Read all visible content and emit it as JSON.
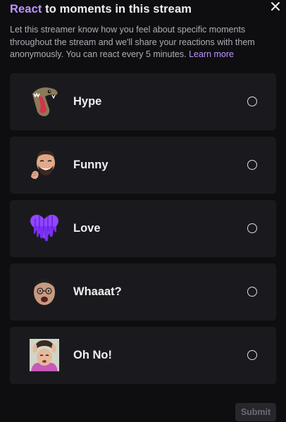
{
  "header": {
    "title_accent": "React",
    "title_rest": " to moments in this stream"
  },
  "description": {
    "text": "Let this streamer know how you feel about specific moments throughout the stream and we'll share your reactions with them anonymously. You can react every 5 minutes. ",
    "link": "Learn more"
  },
  "options": [
    {
      "label": "Hype",
      "emote": "hype-emote-icon"
    },
    {
      "label": "Funny",
      "emote": "funny-emote-icon"
    },
    {
      "label": "Love",
      "emote": "love-emote-icon"
    },
    {
      "label": "Whaaat?",
      "emote": "whaaat-emote-icon"
    },
    {
      "label": "Oh No!",
      "emote": "oh-no-emote-icon"
    }
  ],
  "submit_label": "Submit",
  "colors": {
    "accent": "#bf94ff",
    "background": "#0e0e10",
    "card": "#1a1a1e"
  }
}
